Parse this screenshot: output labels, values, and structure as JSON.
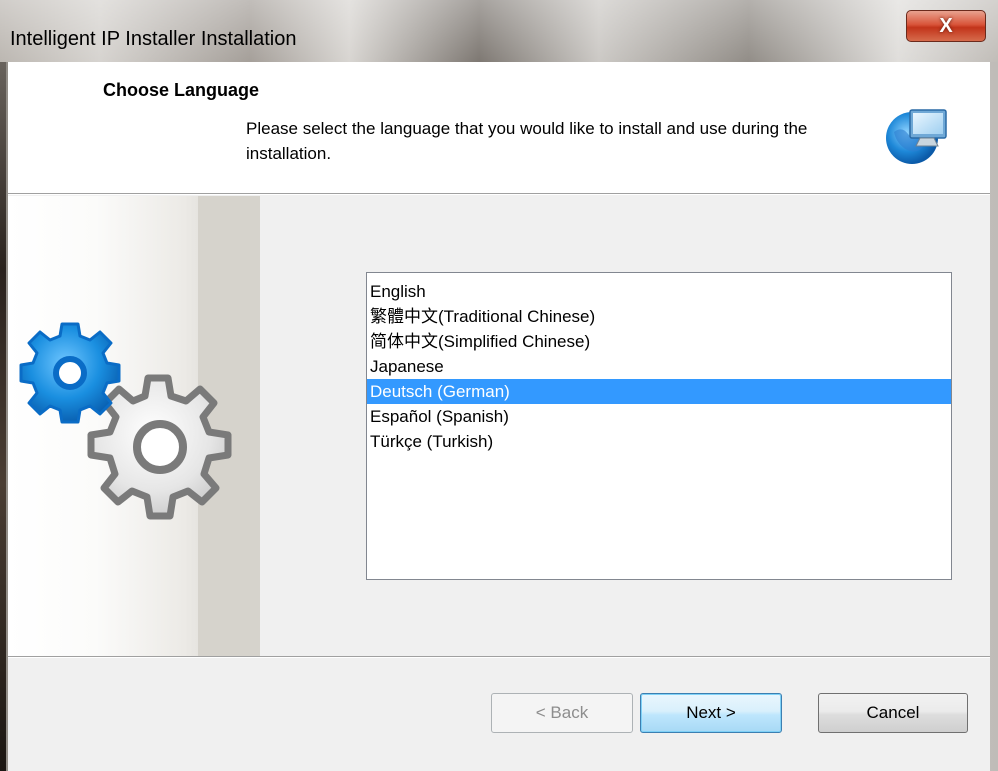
{
  "window": {
    "title": "Intelligent IP Installer Installation",
    "close_label": "X"
  },
  "header": {
    "title": "Choose Language",
    "description": "Please select the language that you would like to install and use during the installation."
  },
  "languages": {
    "items": [
      "English",
      "繁體中文(Traditional Chinese)",
      "简体中文(Simplified Chinese)",
      "Japanese",
      "Deutsch (German)",
      "Español (Spanish)",
      "Türkçe (Turkish)"
    ],
    "selected": "Deutsch (German)"
  },
  "buttons": {
    "back": "< Back",
    "next": "Next >",
    "cancel": "Cancel"
  },
  "colors": {
    "selection": "#3399ff",
    "close_button": "#c2341a",
    "gear_blue": "#1a8fe0",
    "gear_gray": "#8c8c8c"
  },
  "icons": {
    "header": "computer-globe-icon",
    "side": "gears-icon"
  }
}
